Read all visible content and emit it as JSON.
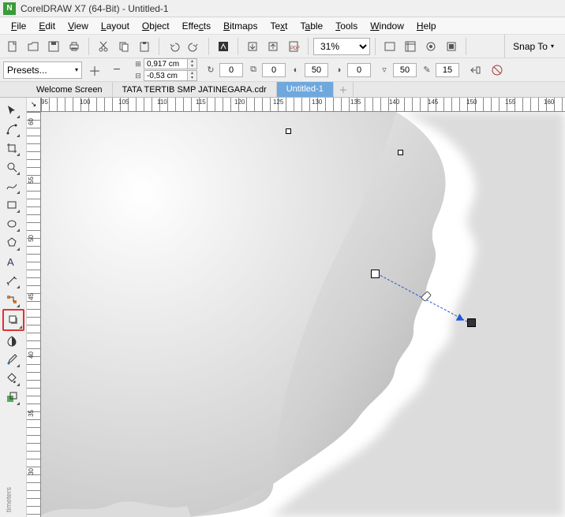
{
  "title": "CorelDRAW X7 (64-Bit) - Untitled-1",
  "menu": [
    "File",
    "Edit",
    "View",
    "Layout",
    "Object",
    "Effects",
    "Bitmaps",
    "Text",
    "Table",
    "Tools",
    "Window",
    "Help"
  ],
  "zoom": "31%",
  "snap_to": "Snap To",
  "property": {
    "presets_label": "Presets...",
    "x": "0,917 cm",
    "y": "-0,53 cm",
    "rot": "0",
    "copies": "0",
    "count3": "50",
    "count4": "0",
    "transp1": "50",
    "transp2": "15"
  },
  "doc_tabs": [
    {
      "label": "Welcome Screen",
      "active": false
    },
    {
      "label": "TATA TERTIB SMP JATINEGARA.cdr",
      "active": false
    },
    {
      "label": "Untitled-1",
      "active": true
    }
  ],
  "ruler_h": [
    "95",
    "100",
    "105",
    "110",
    "115",
    "120",
    "125",
    "130",
    "135",
    "140",
    "145",
    "150",
    "155",
    "160"
  ],
  "ruler_v": [
    "60",
    "55",
    "50",
    "45",
    "40",
    "35",
    "30"
  ],
  "meters_label": "timeters",
  "tools": [
    {
      "name": "pick-tool",
      "fly": true
    },
    {
      "name": "shape-tool",
      "fly": true
    },
    {
      "name": "crop-tool",
      "fly": true
    },
    {
      "name": "zoom-tool",
      "fly": true
    },
    {
      "name": "freehand-tool",
      "fly": true
    },
    {
      "name": "rectangle-tool",
      "fly": true
    },
    {
      "name": "ellipse-tool",
      "fly": true
    },
    {
      "name": "polygon-tool",
      "fly": true
    },
    {
      "name": "text-tool",
      "fly": false
    },
    {
      "name": "parallel-dimension-tool",
      "fly": true
    },
    {
      "name": "connector-tool",
      "fly": true
    },
    {
      "name": "drop-shadow-tool",
      "fly": true,
      "selected": true
    },
    {
      "name": "transparency-tool",
      "fly": false
    },
    {
      "name": "color-eyedropper-tool",
      "fly": true
    },
    {
      "name": "interactive-fill-tool",
      "fly": true
    },
    {
      "name": "smart-fill-tool",
      "fly": true
    }
  ],
  "toolbar_icons": [
    {
      "name": "new-icon"
    },
    {
      "name": "open-icon"
    },
    {
      "name": "save-icon"
    },
    {
      "name": "print-icon"
    },
    {
      "sep": true
    },
    {
      "name": "cut-icon"
    },
    {
      "name": "copy-icon"
    },
    {
      "name": "paste-icon"
    },
    {
      "sep": true
    },
    {
      "name": "undo-icon"
    },
    {
      "name": "redo-icon"
    },
    {
      "sep": true
    },
    {
      "name": "search-icon"
    },
    {
      "sep": true
    },
    {
      "name": "import-icon"
    },
    {
      "name": "export-icon"
    },
    {
      "name": "publish-pdf-icon"
    }
  ],
  "right_toolbar_icons": [
    {
      "name": "fullscreen-icon"
    },
    {
      "name": "show-rulers-icon"
    },
    {
      "name": "show-grid-icon"
    },
    {
      "name": "show-guidelines-icon"
    },
    {
      "sep": true
    },
    {
      "name": "options-icon"
    },
    {
      "name": "app-launcher-icon"
    }
  ]
}
